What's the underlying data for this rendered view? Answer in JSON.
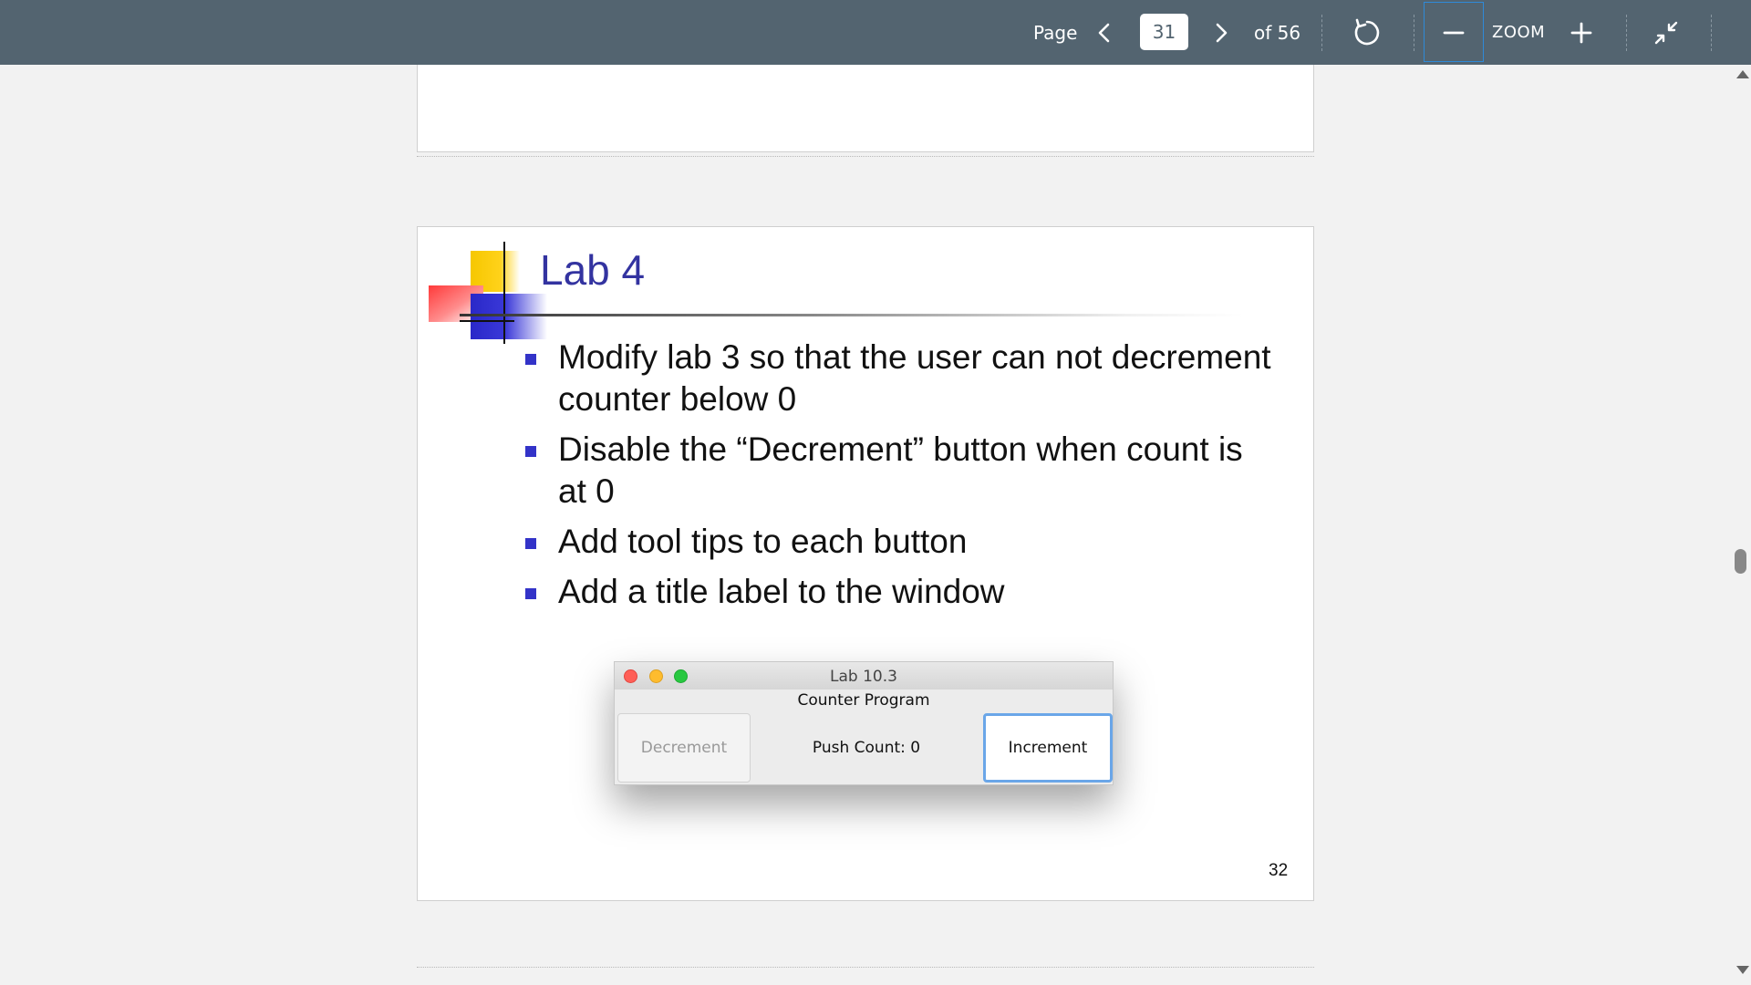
{
  "toolbar": {
    "page_label": "Page",
    "current_page": "31",
    "of_label": "of 56",
    "zoom_label": "ZOOM",
    "icons": {
      "prev": "chevron-left-icon",
      "next": "chevron-right-icon",
      "rotate": "rotate-icon",
      "zoom_out": "minus-icon",
      "zoom_in": "plus-icon",
      "collapse": "collapse-icon"
    }
  },
  "slide": {
    "title": "Lab 4",
    "bullets": [
      "Modify lab 3 so that the user can not decrement counter below 0",
      "Disable the “Decrement” button when count is at 0",
      "Add tool tips to each button",
      "Add a title label to the window"
    ],
    "window": {
      "title": "Lab 10.3",
      "subtitle": "Counter Program",
      "decrement_label": "Decrement",
      "count_label": "Push Count: 0",
      "increment_label": "Increment"
    },
    "page_number": "32"
  },
  "colors": {
    "toolbar_bg": "#536470",
    "focus_border": "#2f8ad8",
    "slide_title": "#3333a0",
    "bullet": "#3333c8"
  }
}
